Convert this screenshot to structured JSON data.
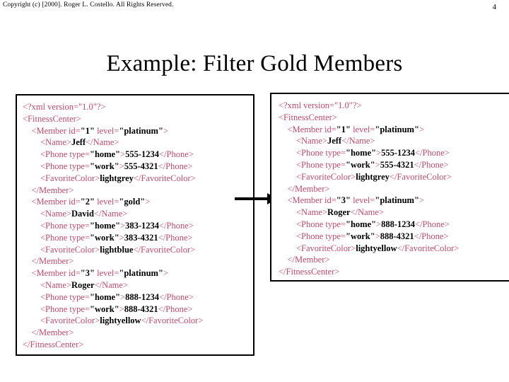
{
  "header": {
    "copyright": "Copyright (c) [2000].  Roger L. Costello.  All Rights Reserved.",
    "page_number": "4"
  },
  "title": "Example: Filter Gold Members",
  "arrow": {
    "icon": "arrow-right-icon",
    "color": "#000000",
    "direction": "right"
  },
  "colors": {
    "tag": "#C04A6B",
    "value": "#000000",
    "border": "#000000",
    "background": "#FFFFFF"
  },
  "input_document": {
    "label": "input-xml-document",
    "lines": [
      [
        {
          "t": "tag",
          "s": "<?xml version=\"1.0\"?>"
        }
      ],
      [
        {
          "t": "tag",
          "s": "<FitnessCenter>"
        }
      ],
      [
        {
          "t": "tag",
          "s": "    <Member id="
        },
        {
          "t": "val",
          "s": "\"1\""
        },
        {
          "t": "tag",
          "s": " level="
        },
        {
          "t": "val",
          "s": "\"platinum\""
        },
        {
          "t": "tag",
          "s": ">"
        }
      ],
      [
        {
          "t": "tag",
          "s": "        <Name>"
        },
        {
          "t": "val",
          "s": "Jeff"
        },
        {
          "t": "tag",
          "s": "</Name>"
        }
      ],
      [
        {
          "t": "tag",
          "s": "        <Phone type="
        },
        {
          "t": "val",
          "s": "\"home\""
        },
        {
          "t": "tag",
          "s": ">"
        },
        {
          "t": "val",
          "s": "555-1234"
        },
        {
          "t": "tag",
          "s": "</Phone>"
        }
      ],
      [
        {
          "t": "tag",
          "s": "        <Phone type="
        },
        {
          "t": "val",
          "s": "\"work\""
        },
        {
          "t": "tag",
          "s": ">"
        },
        {
          "t": "val",
          "s": "555-4321"
        },
        {
          "t": "tag",
          "s": "</Phone>"
        }
      ],
      [
        {
          "t": "tag",
          "s": "        <FavoriteColor>"
        },
        {
          "t": "val",
          "s": "lightgrey"
        },
        {
          "t": "tag",
          "s": "</FavoriteColor>"
        }
      ],
      [
        {
          "t": "tag",
          "s": "    </Member>"
        }
      ],
      [
        {
          "t": "tag",
          "s": "    <Member id="
        },
        {
          "t": "val",
          "s": "\"2\""
        },
        {
          "t": "tag",
          "s": " level="
        },
        {
          "t": "val",
          "s": "\"gold\""
        },
        {
          "t": "tag",
          "s": ">"
        }
      ],
      [
        {
          "t": "tag",
          "s": "        <Name>"
        },
        {
          "t": "val",
          "s": "David"
        },
        {
          "t": "tag",
          "s": "</Name>"
        }
      ],
      [
        {
          "t": "tag",
          "s": "        <Phone type="
        },
        {
          "t": "val",
          "s": "\"home\""
        },
        {
          "t": "tag",
          "s": ">"
        },
        {
          "t": "val",
          "s": "383-1234"
        },
        {
          "t": "tag",
          "s": "</Phone>"
        }
      ],
      [
        {
          "t": "tag",
          "s": "        <Phone type="
        },
        {
          "t": "val",
          "s": "\"work\""
        },
        {
          "t": "tag",
          "s": ">"
        },
        {
          "t": "val",
          "s": "383-4321"
        },
        {
          "t": "tag",
          "s": "</Phone>"
        }
      ],
      [
        {
          "t": "tag",
          "s": "        <FavoriteColor>"
        },
        {
          "t": "val",
          "s": "lightblue"
        },
        {
          "t": "tag",
          "s": "</FavoriteColor>"
        }
      ],
      [
        {
          "t": "tag",
          "s": "    </Member>"
        }
      ],
      [
        {
          "t": "tag",
          "s": "    <Member id="
        },
        {
          "t": "val",
          "s": "\"3\""
        },
        {
          "t": "tag",
          "s": " level="
        },
        {
          "t": "val",
          "s": "\"platinum\""
        },
        {
          "t": "tag",
          "s": ">"
        }
      ],
      [
        {
          "t": "tag",
          "s": "        <Name>"
        },
        {
          "t": "val",
          "s": "Roger"
        },
        {
          "t": "tag",
          "s": "</Name>"
        }
      ],
      [
        {
          "t": "tag",
          "s": "        <Phone type="
        },
        {
          "t": "val",
          "s": "\"home\""
        },
        {
          "t": "tag",
          "s": ">"
        },
        {
          "t": "val",
          "s": "888-1234"
        },
        {
          "t": "tag",
          "s": "</Phone>"
        }
      ],
      [
        {
          "t": "tag",
          "s": "        <Phone type="
        },
        {
          "t": "val",
          "s": "\"work\""
        },
        {
          "t": "tag",
          "s": ">"
        },
        {
          "t": "val",
          "s": "888-4321"
        },
        {
          "t": "tag",
          "s": "</Phone>"
        }
      ],
      [
        {
          "t": "tag",
          "s": "        <FavoriteColor>"
        },
        {
          "t": "val",
          "s": "lightyellow"
        },
        {
          "t": "tag",
          "s": "</FavoriteColor>"
        }
      ],
      [
        {
          "t": "tag",
          "s": "    </Member>"
        }
      ],
      [
        {
          "t": "tag",
          "s": "</FitnessCenter>"
        }
      ]
    ]
  },
  "output_document": {
    "label": "output-xml-document",
    "lines": [
      [
        {
          "t": "tag",
          "s": "<?xml version=\"1.0\"?>"
        }
      ],
      [
        {
          "t": "tag",
          "s": "<FitnessCenter>"
        }
      ],
      [
        {
          "t": "tag",
          "s": "    <Member id="
        },
        {
          "t": "val",
          "s": "\"1\""
        },
        {
          "t": "tag",
          "s": " level="
        },
        {
          "t": "val",
          "s": "\"platinum\""
        },
        {
          "t": "tag",
          "s": ">"
        }
      ],
      [
        {
          "t": "tag",
          "s": "        <Name>"
        },
        {
          "t": "val",
          "s": "Jeff"
        },
        {
          "t": "tag",
          "s": "</Name>"
        }
      ],
      [
        {
          "t": "tag",
          "s": "        <Phone type="
        },
        {
          "t": "val",
          "s": "\"home\""
        },
        {
          "t": "tag",
          "s": ">"
        },
        {
          "t": "val",
          "s": "555-1234"
        },
        {
          "t": "tag",
          "s": "</Phone>"
        }
      ],
      [
        {
          "t": "tag",
          "s": "        <Phone type="
        },
        {
          "t": "val",
          "s": "\"work\""
        },
        {
          "t": "tag",
          "s": ">"
        },
        {
          "t": "val",
          "s": "555-4321"
        },
        {
          "t": "tag",
          "s": "</Phone>"
        }
      ],
      [
        {
          "t": "tag",
          "s": "        <FavoriteColor>"
        },
        {
          "t": "val",
          "s": "lightgrey"
        },
        {
          "t": "tag",
          "s": "</FavoriteColor>"
        }
      ],
      [
        {
          "t": "tag",
          "s": "    </Member>"
        }
      ],
      [
        {
          "t": "tag",
          "s": "    <Member id="
        },
        {
          "t": "val",
          "s": "\"3\""
        },
        {
          "t": "tag",
          "s": " level="
        },
        {
          "t": "val",
          "s": "\"platinum\""
        },
        {
          "t": "tag",
          "s": ">"
        }
      ],
      [
        {
          "t": "tag",
          "s": "        <Name>"
        },
        {
          "t": "val",
          "s": "Roger"
        },
        {
          "t": "tag",
          "s": "</Name>"
        }
      ],
      [
        {
          "t": "tag",
          "s": "        <Phone type="
        },
        {
          "t": "val",
          "s": "\"home\""
        },
        {
          "t": "tag",
          "s": ">"
        },
        {
          "t": "val",
          "s": "888-1234"
        },
        {
          "t": "tag",
          "s": "</Phone>"
        }
      ],
      [
        {
          "t": "tag",
          "s": "        <Phone type="
        },
        {
          "t": "val",
          "s": "\"work\""
        },
        {
          "t": "tag",
          "s": ">"
        },
        {
          "t": "val",
          "s": "888-4321"
        },
        {
          "t": "tag",
          "s": "</Phone>"
        }
      ],
      [
        {
          "t": "tag",
          "s": "        <FavoriteColor>"
        },
        {
          "t": "val",
          "s": "lightyellow"
        },
        {
          "t": "tag",
          "s": "</FavoriteColor>"
        }
      ],
      [
        {
          "t": "tag",
          "s": "    </Member>"
        }
      ],
      [
        {
          "t": "tag",
          "s": "</FitnessCenter>"
        }
      ]
    ]
  }
}
